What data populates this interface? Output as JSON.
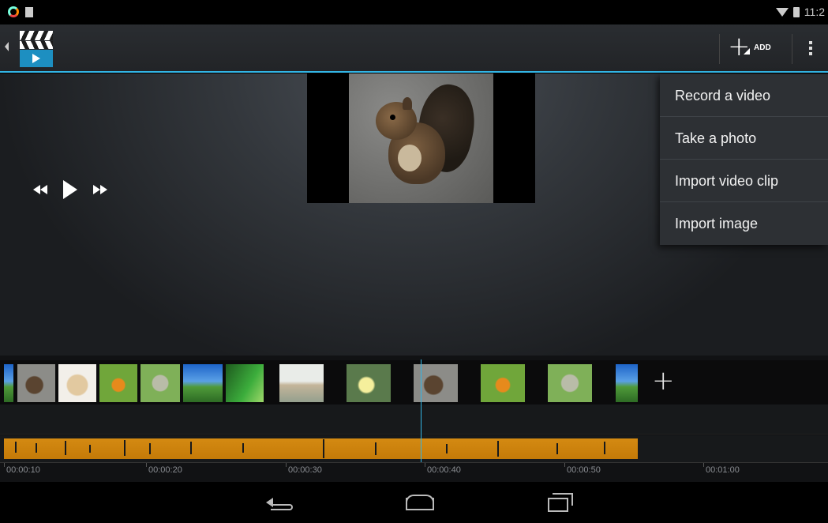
{
  "status_bar": {
    "time": "11:2",
    "notification_icons": [
      "app-notification-icon",
      "storage-icon"
    ],
    "system_icons": [
      "wifi-icon",
      "battery-icon"
    ]
  },
  "action_bar": {
    "app_icon": "clapperboard-play-icon",
    "add_label": "ADD",
    "add_icon": "plus-icon",
    "overflow_icon": "overflow-menu-icon",
    "accent_color": "#33b5e5"
  },
  "add_menu": {
    "items": [
      {
        "label": "Record a video"
      },
      {
        "label": "Take a photo"
      },
      {
        "label": "Import video clip"
      },
      {
        "label": "Import image"
      }
    ]
  },
  "player": {
    "controls": [
      "rewind-icon",
      "play-icon",
      "fast-forward-icon"
    ],
    "preview_subject": "squirrel-photo"
  },
  "timeline": {
    "clips": [
      "squirrel",
      "puppy",
      "bird",
      "owl",
      "sky",
      "plant",
      "beach",
      "duckling",
      "squirrel",
      "bird",
      "owl",
      "sky"
    ],
    "add_media_icon": "plus-icon",
    "audio_color": "#d48a12",
    "ruler_labels": [
      "00:00:10",
      "00:00:20",
      "00:00:30",
      "00:00:40",
      "00:00:50",
      "00:01:00"
    ]
  },
  "nav_bar": {
    "icons": [
      "back-icon",
      "home-icon",
      "recents-icon"
    ]
  }
}
